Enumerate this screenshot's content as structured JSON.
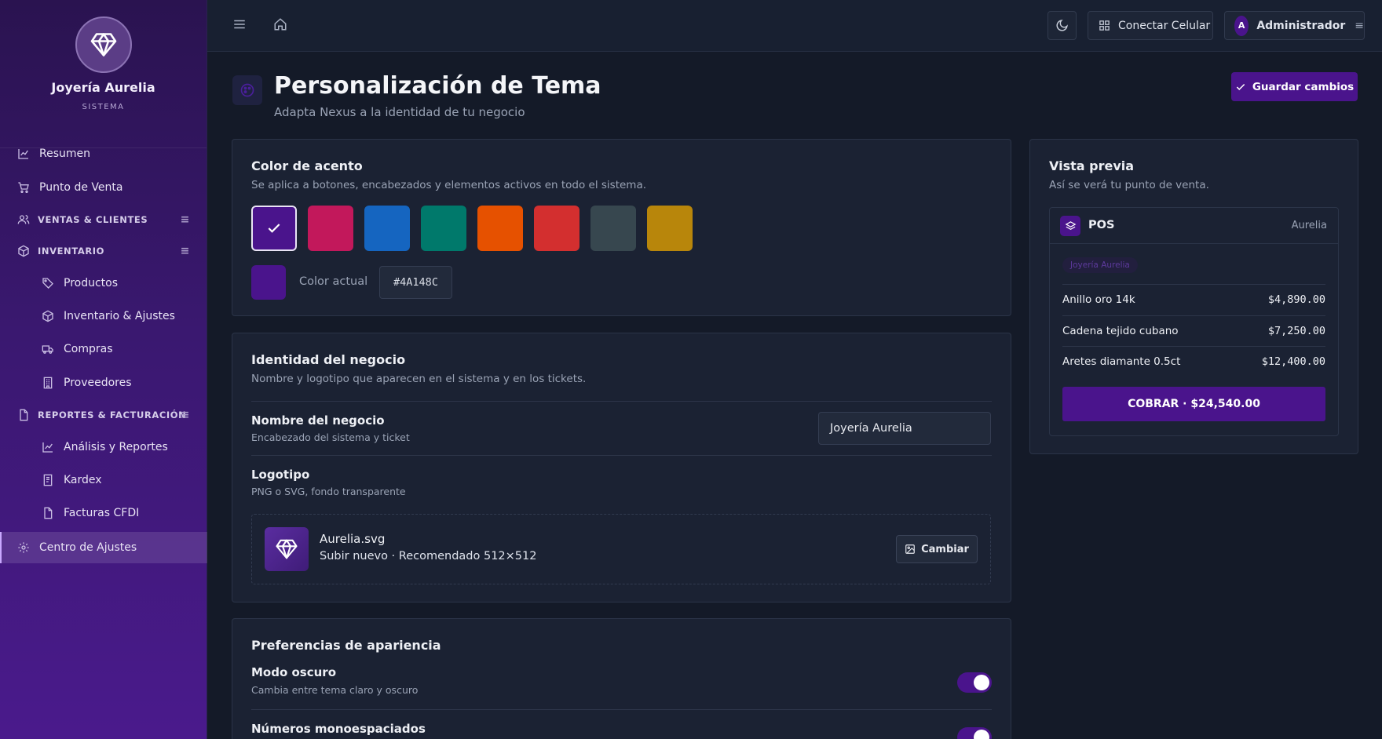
{
  "brand": {
    "name": "Joyería Aurelia",
    "subtitle": "SISTEMA"
  },
  "sidebar": {
    "items": [
      {
        "label": "Resumen",
        "icon": "chart-line-icon"
      },
      {
        "label": "Punto de Venta",
        "icon": "cart-icon"
      },
      {
        "label": "VENTAS & CLIENTES",
        "icon": "users-icon",
        "group": true
      },
      {
        "label": "INVENTARIO",
        "icon": "box-icon",
        "group": true
      },
      {
        "label": "Productos",
        "icon": "tag-icon"
      },
      {
        "label": "Inventario & Ajustes",
        "icon": "box-icon"
      },
      {
        "label": "Compras",
        "icon": "truck-icon"
      },
      {
        "label": "Proveedores",
        "icon": "building-icon"
      },
      {
        "label": "REPORTES & FACTURACIÓN",
        "icon": "file-icon",
        "group": true
      },
      {
        "label": "Análisis y Reportes",
        "icon": "chart-line-icon"
      },
      {
        "label": "Kardex",
        "icon": "document-icon"
      },
      {
        "label": "Facturas CFDI",
        "icon": "file-icon"
      },
      {
        "label": "Centro de Ajustes",
        "icon": "gear-icon",
        "active": true
      }
    ]
  },
  "topbar": {
    "connect_label": "Conectar Celular",
    "user_initial": "A",
    "user_name": "Administrador"
  },
  "page": {
    "title": "Personalización de Tema",
    "subtitle": "Adapta Nexus a la identidad de tu negocio",
    "save_label": "Guardar cambios"
  },
  "accent": {
    "title": "Color de acento",
    "description": "Se aplica a botones, encabezados y elementos activos en todo el sistema.",
    "swatches": [
      "#4A148C",
      "#C2185B",
      "#1565C0",
      "#00796B",
      "#E65100",
      "#D32F2F",
      "#37474F",
      "#B8860B"
    ],
    "selected_index": 0,
    "current_label": "Color actual",
    "current_hex": "#4A148C"
  },
  "identity": {
    "title": "Identidad del negocio",
    "description": "Nombre y logotipo que aparecen en el sistema y en los tickets.",
    "name_label": "Nombre del negocio",
    "name_desc": "Encabezado del sistema y ticket",
    "name_value": "Joyería Aurelia",
    "logo_label": "Logotipo",
    "logo_desc": "PNG o SVG, fondo transparente",
    "logo_file": "Aurelia.svg",
    "logo_hint": "Subir nuevo · Recomendado 512×512",
    "change_label": "Cambiar"
  },
  "appearance": {
    "title": "Preferencias de apariencia",
    "dark_label": "Modo oscuro",
    "dark_desc": "Cambia entre tema claro y oscuro",
    "dark_on": true,
    "mono_label": "Números monoespaciados",
    "mono_on": true
  },
  "preview": {
    "title": "Vista previa",
    "description": "Así se verá tu punto de venta.",
    "pos_title": "POS",
    "pos_brand": "Aurelia",
    "chip": "Joyería Aurelia",
    "rows": [
      {
        "name": "Anillo oro 14k",
        "price": "$4,890.00"
      },
      {
        "name": "Cadena tejido cubano",
        "price": "$7,250.00"
      },
      {
        "name": "Aretes diamante 0.5ct",
        "price": "$12,400.00"
      }
    ],
    "pay_label": "COBRAR · $24,540.00"
  }
}
